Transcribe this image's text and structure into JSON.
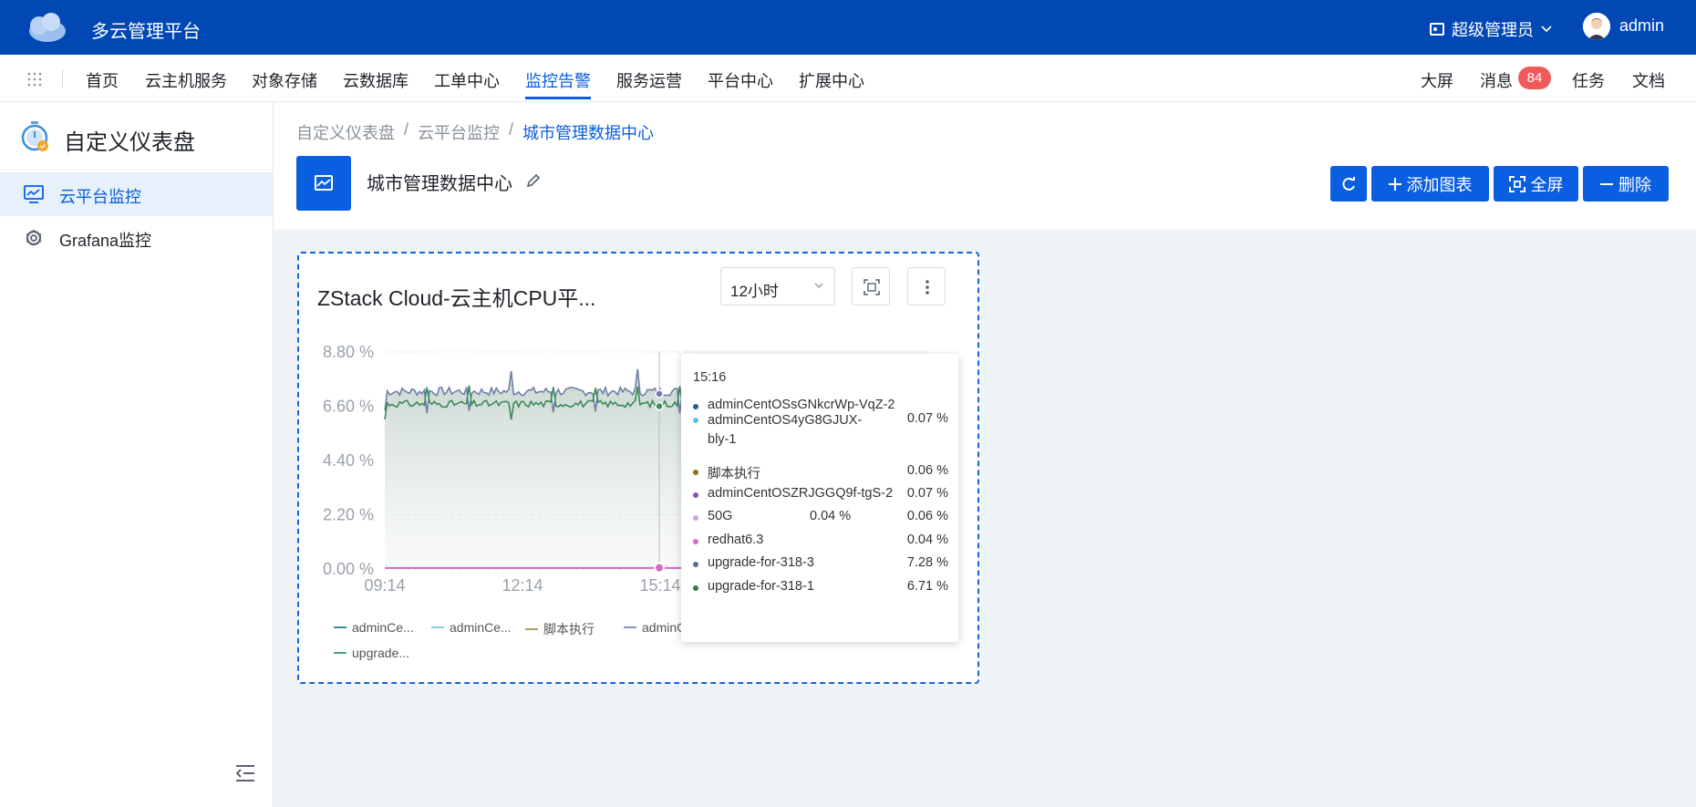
{
  "header": {
    "app_title": "多云管理平台",
    "role_label": "超级管理员",
    "user_name": "admin"
  },
  "nav": {
    "items": [
      "首页",
      "云主机服务",
      "对象存储",
      "云数据库",
      "工单中心",
      "监控告警",
      "服务运营",
      "平台中心",
      "扩展中心"
    ],
    "active": "监控告警",
    "right": {
      "big_screen": "大屏",
      "messages": "消息",
      "message_count": "84",
      "tasks": "任务",
      "docs": "文档"
    }
  },
  "sidebar": {
    "title": "自定义仪表盘",
    "items": [
      {
        "label": "云平台监控",
        "icon": "monitor-chart-icon",
        "active": true
      },
      {
        "label": "Grafana监控",
        "icon": "grafana-icon",
        "active": false
      }
    ]
  },
  "breadcrumb": [
    "自定义仪表盘",
    "云平台监控",
    "城市管理数据中心"
  ],
  "dashboard": {
    "title": "城市管理数据中心",
    "buttons": {
      "add_chart": "添加图表",
      "fullscreen": "全屏",
      "delete": "删除"
    }
  },
  "card": {
    "title": "ZStack Cloud-云主机CPU平...",
    "range": "12小时"
  },
  "chart_data": {
    "type": "line",
    "title": "ZStack Cloud-云主机CPU平...",
    "x_ticks": [
      "09:14",
      "12:14",
      "15:14"
    ],
    "y_ticks": [
      "0.00 %",
      "2.20 %",
      "4.40 %",
      "6.60 %",
      "8.80 %"
    ],
    "ylim": [
      0,
      8.8
    ],
    "series": [
      {
        "name": "upgrade-for-318-3",
        "color": "#6f7fa8",
        "level": 7.2
      },
      {
        "name": "upgrade-for-318-1",
        "color": "#3a8a5a",
        "level": 6.7
      },
      {
        "name": "redhat6.3",
        "color": "#d16bc4",
        "level": 0.04
      }
    ],
    "legend": [
      {
        "label": "adminCe...",
        "color": "#3a8a9a"
      },
      {
        "label": "adminCe...",
        "color": "#8ec7e3"
      },
      {
        "label": "脚本执行",
        "color": "#b0a060"
      },
      {
        "label": "adminC",
        "color": "#8a93c0"
      },
      {
        "label": "upgrade...",
        "color": "#4aa07a"
      }
    ]
  },
  "tooltip": {
    "time": "15:16",
    "rows": [
      {
        "name": "adminCentOSsGNkcrWp-VqZ-2",
        "value": "",
        "color": "#1f5f8a"
      },
      {
        "name": "adminCentOS4yG8GJUX-bly-1",
        "value": "0.07 %",
        "color": "#5bc0de"
      },
      {
        "name": "脚本执行",
        "value": "0.06 %",
        "color": "#8a7a10"
      },
      {
        "name": "adminCentOSZRJGGQ9f-tgS-2",
        "value": "0.07 %",
        "color": "#8a4fc7"
      },
      {
        "name": "50G",
        "mid": "0.04 %",
        "value": "0.06 %",
        "color": "#c9a6e8"
      },
      {
        "name": "redhat6.3",
        "value": "0.04 %",
        "color": "#d16bc4"
      },
      {
        "name": "upgrade-for-318-3",
        "value": "7.28 %",
        "color": "#5a6a95"
      },
      {
        "name": "upgrade-for-318-1",
        "value": "6.71 %",
        "color": "#2f7a4a"
      }
    ]
  }
}
